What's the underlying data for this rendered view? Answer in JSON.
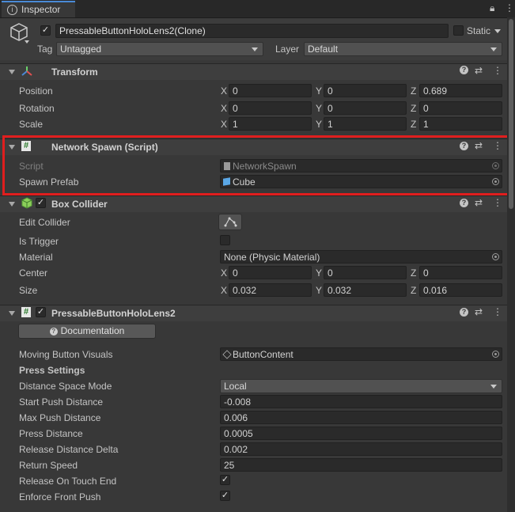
{
  "tab": {
    "title": "Inspector"
  },
  "object": {
    "name": "PressableButtonHoloLens2(Clone)",
    "static_label": "Static",
    "tag_label": "Tag",
    "tag_value": "Untagged",
    "layer_label": "Layer",
    "layer_value": "Default"
  },
  "transform": {
    "title": "Transform",
    "position": {
      "label": "Position",
      "x": "0",
      "y": "0",
      "z": "0.689"
    },
    "rotation": {
      "label": "Rotation",
      "x": "0",
      "y": "0",
      "z": "0"
    },
    "scale": {
      "label": "Scale",
      "x": "1",
      "y": "1",
      "z": "1"
    }
  },
  "axes": {
    "x": "X",
    "y": "Y",
    "z": "Z"
  },
  "network_spawn": {
    "title": "Network Spawn (Script)",
    "script_label": "Script",
    "script_value": "NetworkSpawn",
    "prefab_label": "Spawn Prefab",
    "prefab_value": "Cube",
    "highlight_color": "#e01e1e"
  },
  "box_collider": {
    "title": "Box Collider",
    "edit_label": "Edit Collider",
    "trigger_label": "Is Trigger",
    "material_label": "Material",
    "material_value": "None (Physic Material)",
    "center": {
      "label": "Center",
      "x": "0",
      "y": "0",
      "z": "0"
    },
    "size": {
      "label": "Size",
      "x": "0.032",
      "y": "0.032",
      "z": "0.016"
    }
  },
  "pressable": {
    "title": "PressableButtonHoloLens2",
    "doc_button": "Documentation",
    "moving_label": "Moving Button Visuals",
    "moving_value": "ButtonContent",
    "press_settings": "Press Settings",
    "rows": [
      {
        "label": "Distance Space Mode",
        "value": "Local"
      },
      {
        "label": "Start Push Distance",
        "value": "-0.008"
      },
      {
        "label": "Max Push Distance",
        "value": "0.006"
      },
      {
        "label": "Press Distance",
        "value": "0.0005"
      },
      {
        "label": "Release Distance Delta",
        "value": "0.002"
      },
      {
        "label": "Return Speed",
        "value": "25"
      }
    ],
    "release_touch_label": "Release On Touch End",
    "enforce_front_label": "Enforce Front Push"
  }
}
